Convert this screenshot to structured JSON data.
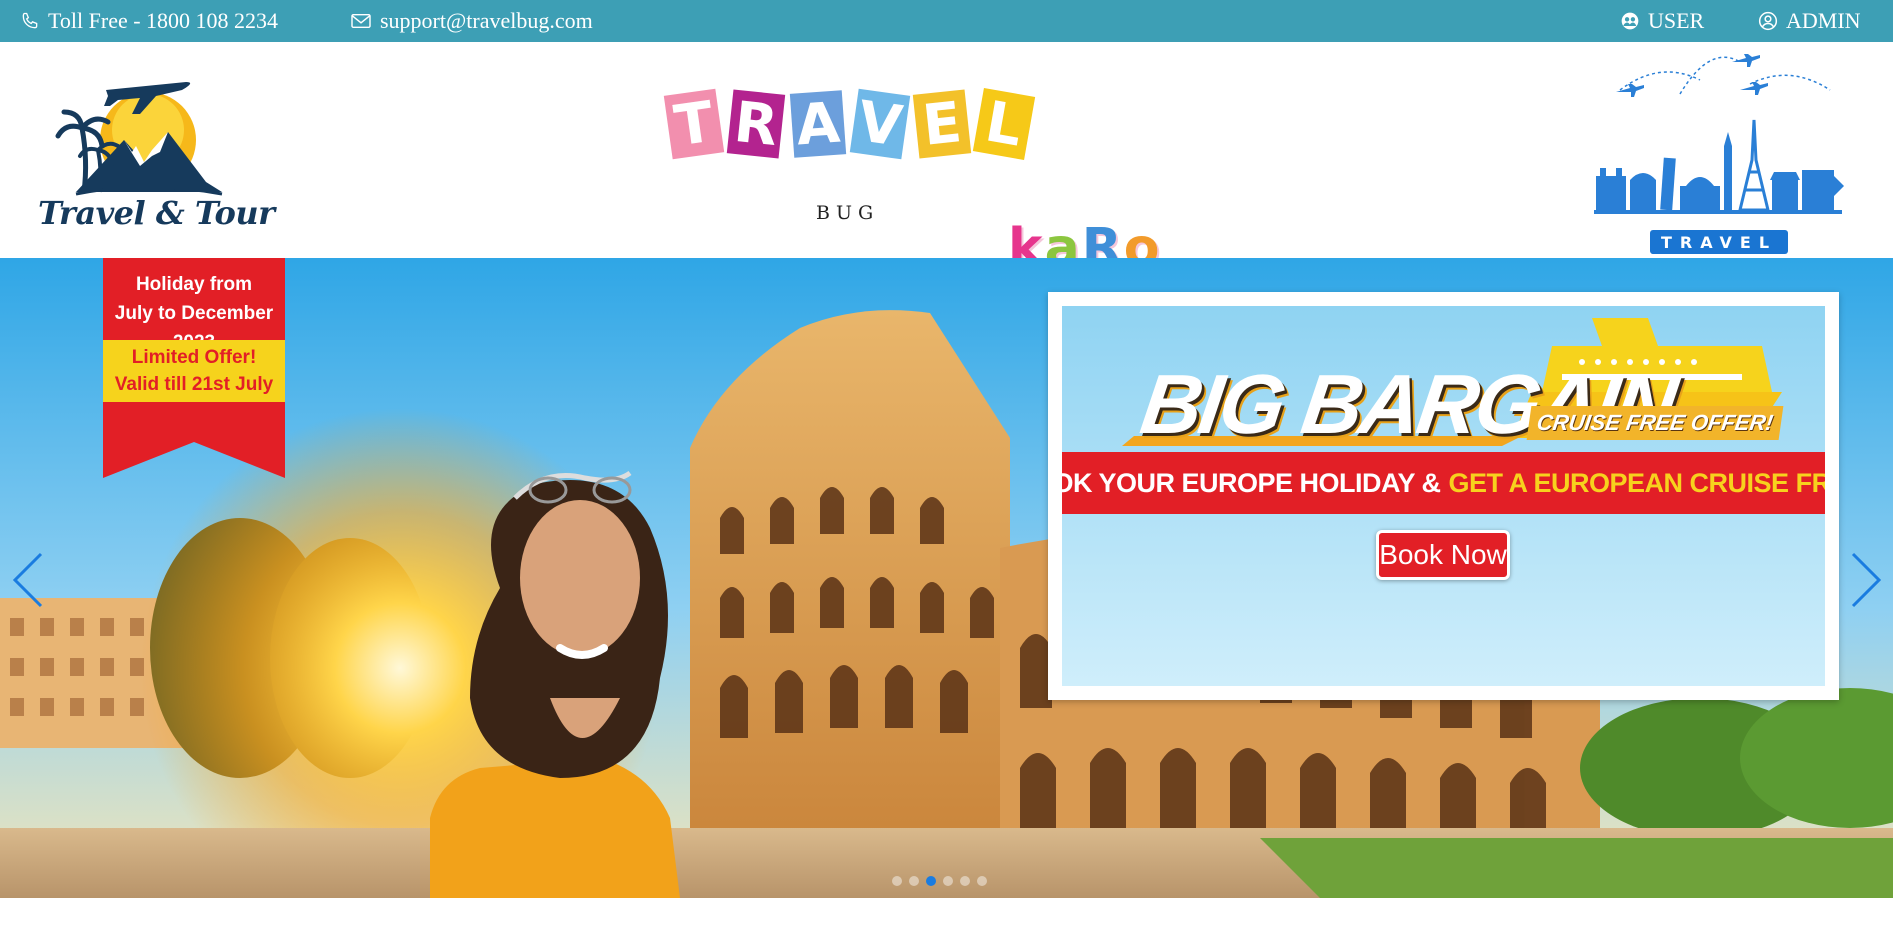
{
  "topbar": {
    "toll_free": "Toll Free - 1800 108 2234",
    "email": "support@travelbug.com",
    "user_label": "USER",
    "admin_label": "ADMIN",
    "background": "#3d9fb5"
  },
  "header": {
    "left_logo_caption": "Travel & Tour",
    "brand_letters": [
      "T",
      "R",
      "A",
      "V",
      "E",
      "L"
    ],
    "brand_colors": [
      "#f28fae",
      "#b3238f",
      "#6c9fdc",
      "#6fb8e8",
      "#f3c12a",
      "#f6c918"
    ],
    "brand_sub": "BUG",
    "brand_karo_letters": [
      "k",
      "a",
      "R",
      "o"
    ],
    "brand_karo_colors": [
      "#e6358d",
      "#8cc63f",
      "#3f8fd8",
      "#f29b2b"
    ],
    "right_logo_caption": "TRAVEL"
  },
  "hero": {
    "ribbon_line1": "Holiday from",
    "ribbon_line2": "July to December 2023",
    "ribbon_line3": "Limited Offer!",
    "ribbon_line4": "Valid till 21st July",
    "headline": "BIG BARGAIN",
    "headline_tag": "CRUISE FREE OFFER!",
    "strip_white": "BOOK YOUR EUROPE HOLIDAY &",
    "strip_yellow": "GET A EUROPEAN CRUISE FREE!",
    "cta": "Book Now",
    "slide_count": 6,
    "active_slide": 3
  },
  "icons": {
    "phone": "phone-icon",
    "email": "envelope-icon",
    "user": "users-icon",
    "admin": "user-circle-icon",
    "prev": "chevron-left-icon",
    "next": "chevron-right-icon"
  }
}
